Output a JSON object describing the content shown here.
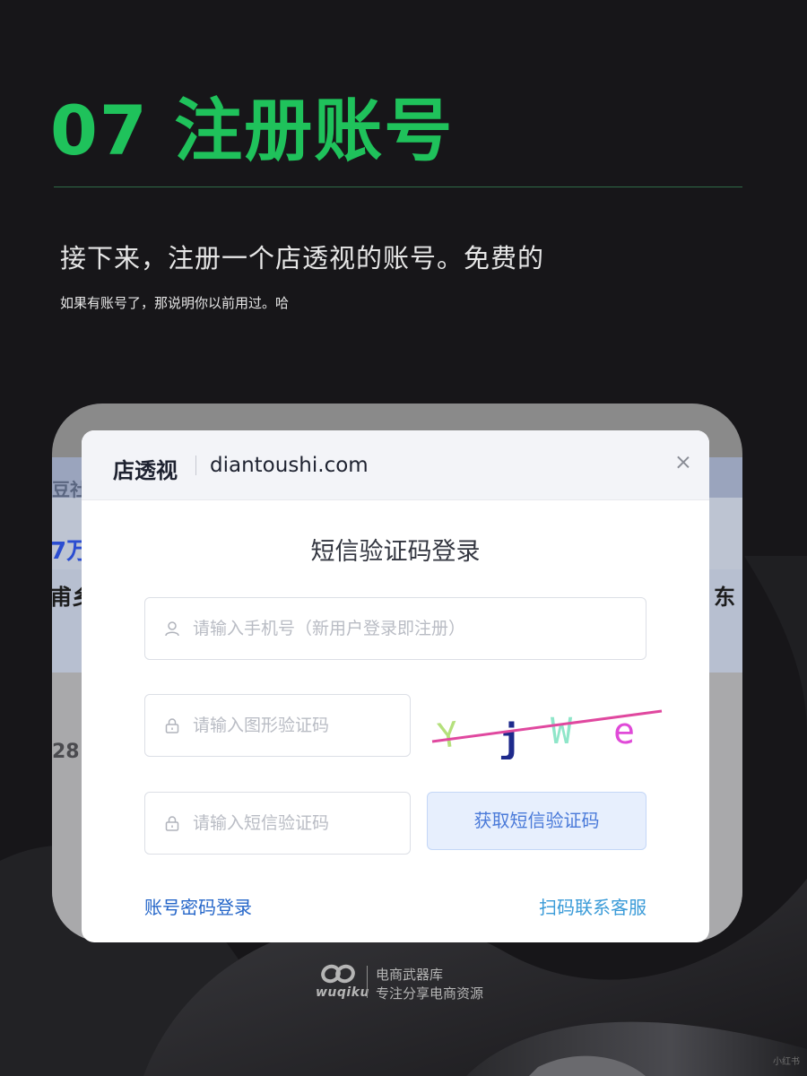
{
  "page": {
    "heading": "07 注册账号",
    "subtitle": "接下来，注册一个店透视的账号。免费的",
    "note": "如果有账号了，那说明你以前用过。哈",
    "accent_color": "#1fc25b"
  },
  "background_fragments": [
    "豆社",
    "7万",
    "甫乡",
    "28",
    "东"
  ],
  "dialog": {
    "brand": "店透视",
    "domain": "diantoushi.com",
    "close_icon": "close-icon",
    "title": "短信验证码登录",
    "phone_placeholder": "请输入手机号（新用户登录即注册）",
    "image_code_placeholder": "请输入图形验证码",
    "sms_code_placeholder": "请输入短信验证码",
    "captcha_text": "Yjwe",
    "get_sms_button": "获取短信验证码",
    "password_login_link": "账号密码登录",
    "contact_support_link": "扫码联系客服",
    "icons": {
      "phone": "user-icon",
      "image_code": "lock-icon",
      "sms_code": "lock-icon"
    }
  },
  "watermark": {
    "logo_text": "wuqiku",
    "line1": "电商武器库",
    "line2": "专注分享电商资源"
  },
  "corner_tag": "小红书"
}
